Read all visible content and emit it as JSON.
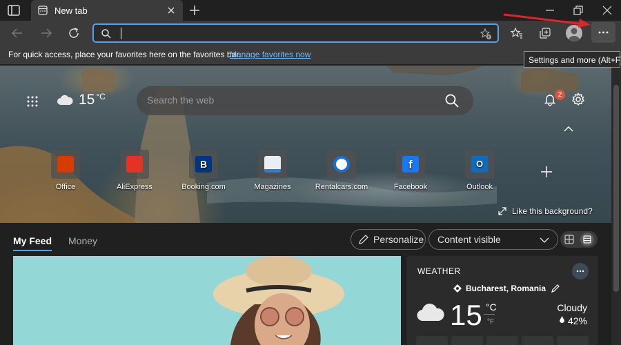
{
  "browser": {
    "tab": {
      "title": "New tab"
    },
    "address": {
      "placeholder": ""
    },
    "favorites_bar": {
      "text": "For quick access, place your favorites here on the favorites bar.",
      "link": "Manage favorites now"
    },
    "tooltip": "Settings and more (Alt+F)"
  },
  "newtab": {
    "weather_mini": {
      "temp": "15",
      "unit": "°C"
    },
    "search_placeholder": "Search the web",
    "notification_count": "2",
    "tiles": [
      {
        "label": "Office",
        "color": "#d83b01"
      },
      {
        "label": "AliExpress",
        "color": "#e43225"
      },
      {
        "label": "Booking.com",
        "color": "#003580"
      },
      {
        "label": "Magazines",
        "color": "#2f7fd0"
      },
      {
        "label": "Rentalcars.com",
        "color": "#1a6fd1"
      },
      {
        "label": "Facebook",
        "color": "#1877f2"
      },
      {
        "label": "Outlook",
        "color": "#0f6cbd"
      }
    ],
    "like_background": "Like this background?"
  },
  "feed": {
    "tabs": [
      "My Feed",
      "Money"
    ],
    "personalize_label": "Personalize",
    "content_visibility": "Content visible"
  },
  "weather_card": {
    "title": "WEATHER",
    "location": "Bucharest, Romania",
    "temp": "15",
    "unit_c": "°C",
    "unit_f": "°F",
    "condition": "Cloudy",
    "humidity": "42%"
  },
  "colors": {
    "accent": "#5aa0e6",
    "link": "#73b7ff",
    "badge": "#d4583a",
    "annotation_arrow": "#e0242a"
  }
}
